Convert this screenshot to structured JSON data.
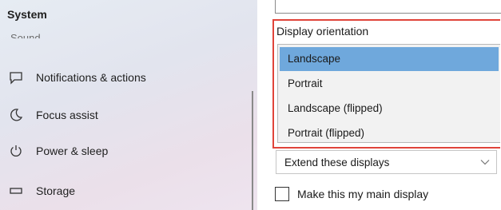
{
  "sidebar": {
    "title": "System",
    "partial_item": "Sound",
    "items": [
      {
        "label": "Notifications & actions",
        "icon": "notifications-icon"
      },
      {
        "label": "Focus assist",
        "icon": "moon-icon"
      },
      {
        "label": "Power & sleep",
        "icon": "power-icon"
      },
      {
        "label": "Storage",
        "icon": "storage-icon"
      }
    ]
  },
  "display": {
    "orientation_label": "Display orientation",
    "orientation_options": [
      "Landscape",
      "Portrait",
      "Landscape (flipped)",
      "Portrait (flipped)"
    ],
    "selected_option": "Landscape",
    "multiple_displays_value": "Extend these displays",
    "main_display_checkbox_label": "Make this my main display",
    "main_display_checked": false
  },
  "colors": {
    "highlight": "#e0443a",
    "selected_option": "#6fa8dc"
  }
}
